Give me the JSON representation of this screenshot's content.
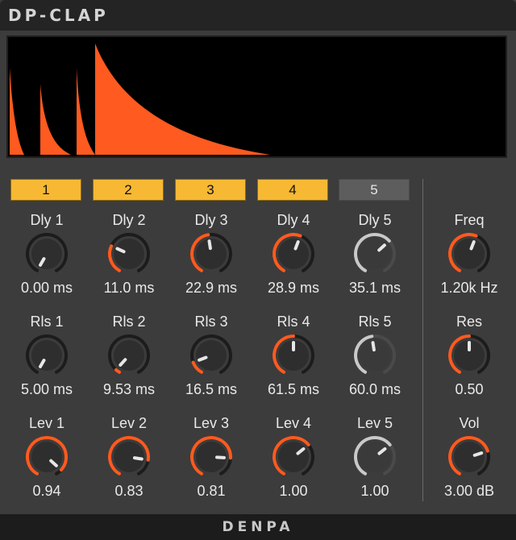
{
  "plugin": {
    "title": "DP-CLAP",
    "brand": "DENPA"
  },
  "colors": {
    "accent": "#ff5a1f",
    "button_on": "#f7b833",
    "knob_body": "#252525",
    "knob_track_inactive": "#1c1c1c",
    "disabled": "#c9c9c9",
    "envelope": "#ff5a1f"
  },
  "channels": [
    {
      "label": "1",
      "enabled": true,
      "delay": {
        "label": "Dly 1",
        "value": "0.00 ms",
        "level": 0.0
      },
      "release": {
        "label": "Rls 1",
        "value": "5.00 ms",
        "level": 0.0
      },
      "level": {
        "label": "Lev 1",
        "value": "0.94",
        "level": 0.94
      }
    },
    {
      "label": "2",
      "enabled": true,
      "delay": {
        "label": "Dly 2",
        "value": "11.0 ms",
        "level": 0.28
      },
      "release": {
        "label": "Rls 2",
        "value": "9.53 ms",
        "level": 0.04
      },
      "level": {
        "label": "Lev 2",
        "value": "0.83",
        "level": 0.83
      }
    },
    {
      "label": "3",
      "enabled": true,
      "delay": {
        "label": "Dly 3",
        "value": "22.9 ms",
        "level": 0.47
      },
      "release": {
        "label": "Rls 3",
        "value": "16.5 ms",
        "level": 0.13
      },
      "level": {
        "label": "Lev 3",
        "value": "0.81",
        "level": 0.81
      }
    },
    {
      "label": "4",
      "enabled": true,
      "delay": {
        "label": "Dly 4",
        "value": "28.9 ms",
        "level": 0.57
      },
      "release": {
        "label": "Rls 4",
        "value": "61.5 ms",
        "level": 0.5
      },
      "level": {
        "label": "Lev 4",
        "value": "1.00",
        "level": 0.67
      }
    },
    {
      "label": "5",
      "enabled": false,
      "delay": {
        "label": "Dly 5",
        "value": "35.1 ms",
        "level": 0.66
      },
      "release": {
        "label": "Rls 5",
        "value": "60.0 ms",
        "level": 0.47
      },
      "level": {
        "label": "Lev 5",
        "value": "1.00",
        "level": 0.67
      }
    }
  ],
  "filter": {
    "freq": {
      "label": "Freq",
      "value": "1.20k Hz",
      "level": 0.57
    },
    "res": {
      "label": "Res",
      "value": "0.50",
      "level": 0.5
    },
    "vol": {
      "label": "Vol",
      "value": "3.00 dB",
      "level": 0.74
    }
  }
}
